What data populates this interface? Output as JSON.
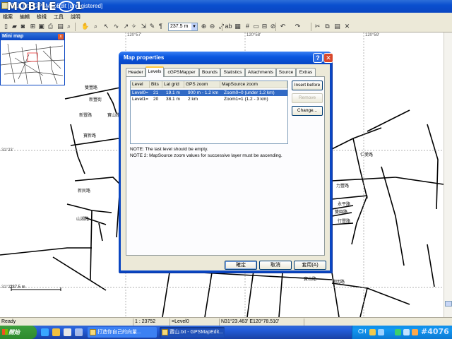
{
  "window": {
    "title": "寶山.txt - GPSMapEdit [unregistered]",
    "brand_word": "MOBILE",
    "brand_digit": "1"
  },
  "menubar": {
    "items": [
      "檔案",
      "編輯",
      "檢視",
      "工具",
      "說明"
    ]
  },
  "toolbar": {
    "zoom_value": "237.5 m"
  },
  "minimap": {
    "title": "Mini map"
  },
  "map": {
    "top_coords": [
      "120°57'",
      "120°58'",
      "120°59'"
    ],
    "left_coords": [
      "31°23'",
      "31°22'"
    ],
    "scale_label": "237.5 m",
    "streets": [
      "雙豐路",
      "寶新路",
      "新豐路",
      "寶山路",
      "新民路",
      "山湖路",
      "仁愛路",
      "力豐路",
      "永平路",
      "行豐路",
      "雙園路",
      "寶明路",
      "寶山路",
      "新豐街"
    ]
  },
  "dialog": {
    "title": "Map properties",
    "help_label": "?",
    "close_label": "✕",
    "tabs": [
      "Header",
      "Levels",
      "cGPSMapper",
      "Bounds",
      "Statistics",
      "Attachments",
      "Source",
      "Extras"
    ],
    "active_tab": "Levels",
    "list": {
      "columns": [
        "Level",
        "Bits",
        "Lat grid",
        "GPS zoom",
        "MapSource zoom"
      ],
      "rows": [
        {
          "level": "Level0=",
          "bits": "21",
          "lat_grid": "19.1 m",
          "gps_zoom": "900 m - 1.2 km",
          "mapsource_zoom": "Zoom0=0 (under 1.2 km)",
          "selected": true
        },
        {
          "level": "Level1=",
          "bits": "20",
          "lat_grid": "38.1 m",
          "gps_zoom": "2 km",
          "mapsource_zoom": "Zoom1=1 (1.2 - 3 km)",
          "selected": false
        }
      ]
    },
    "buttons": {
      "insert_before": "Insert before",
      "remove": "Remove",
      "change": "Change..."
    },
    "notes": [
      "NOTE: The last level should be empty.",
      "NOTE 2: MapSource zoom values for successive layer must be ascending."
    ],
    "ok_label": "確定",
    "cancel_label": "取消",
    "apply_label": "套用(A)"
  },
  "statusbar": {
    "ready": "Ready",
    "scale": "1 : 23752",
    "level": "=Level0",
    "coords": "N31°23.463' E120°78.510'"
  },
  "taskbar": {
    "start_label": "開始",
    "tasks": [
      "打造你自己的向量...",
      "寶山.txt - GPSMapEdit..."
    ],
    "tray_lang": "CH"
  },
  "watermark": "#4076",
  "colors": {
    "title_blue": "#0a46c2",
    "selection": "#316ac5",
    "taskbar_blue": "#245edb",
    "start_green": "#2e8b2e",
    "window_face": "#ece9d8"
  },
  "icons": [
    "new-icon",
    "open-icon",
    "save-icon",
    "print-icon",
    "undo-icon",
    "redo-icon",
    "hand-icon",
    "select-icon",
    "zoom-in-icon",
    "zoom-out-icon",
    "grid-icon",
    "cut-icon",
    "copy-icon",
    "paste-icon",
    "delete-icon"
  ]
}
